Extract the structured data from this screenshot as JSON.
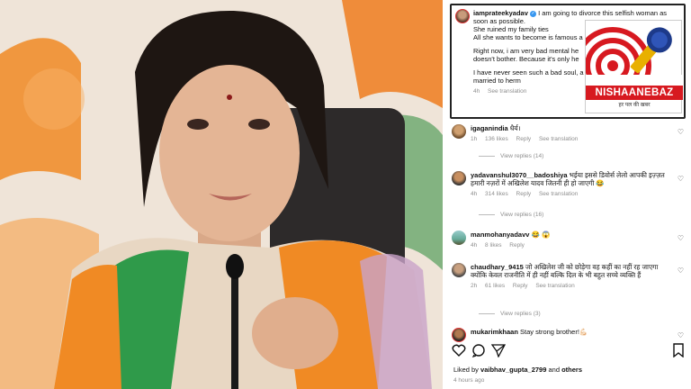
{
  "post": {
    "username": "iamprateekyadav",
    "lines": [
      "I am going to divorce this selfish woman as",
      "soon as possible.",
      "She ruined my family ties",
      "All she wants to become is famous a",
      "",
      "Right now, i am very bad mental he",
      "doesn't bother. Because it's only he",
      "",
      "I have never seen such a bad soul, a",
      "married to herm"
    ],
    "time": "4h",
    "see_translation": "See translation"
  },
  "logo": {
    "name": "NISHAANEBAZ",
    "tagline": "हर पल की खबर"
  },
  "comments": [
    {
      "username": "igaganindia",
      "text": "धैर्य।",
      "time": "1h",
      "likes": "136 likes",
      "reply": "Reply",
      "translate": "See translation",
      "replies": "View replies (14)"
    },
    {
      "username": "yadavanshul3070__badoshiya",
      "text": "भईया इससे डिवोर्स लेलो आपकी इज़्ज़त हमारी नज़रों में अखिलेश यादव जितनी ही हो जाएगी 😂",
      "time": "4h",
      "likes": "314 likes",
      "reply": "Reply",
      "translate": "See translation",
      "replies": "View replies (16)"
    },
    {
      "username": "manmohanyadavv",
      "text": "😂 😱",
      "time": "4h",
      "likes": "8 likes",
      "reply": "Reply",
      "translate": "",
      "replies": ""
    },
    {
      "username": "chaudhary_9415",
      "text": "जो अखिलेश जी को छोड़ेगा वह कहीं का नहीं रह जाएगा क्योंकि केवल राजनीति में ही नहीं बल्कि दिल के भी बहुत सच्चे व्यक्ति हैं",
      "time": "2h",
      "likes": "61 likes",
      "reply": "Reply",
      "translate": "See translation",
      "replies": "View replies (3)"
    },
    {
      "username": "mukarimkhaan",
      "text": "Stay strong brother!💪🏻",
      "time": "",
      "likes": "",
      "reply": "",
      "translate": "",
      "replies": ""
    }
  ],
  "footer": {
    "liked_prefix": "Liked by ",
    "liked_user": "vaibhav_gupta_2799",
    "liked_and": " and ",
    "liked_others": "others",
    "time_ago": "4 hours ago"
  },
  "icons": [
    "heart-icon",
    "comment-icon",
    "share-icon",
    "bookmark-icon",
    "verified-icon"
  ],
  "colors": {
    "accent_red": "#d71920",
    "muted": "#8e8e8e",
    "verified": "#3897f0"
  }
}
